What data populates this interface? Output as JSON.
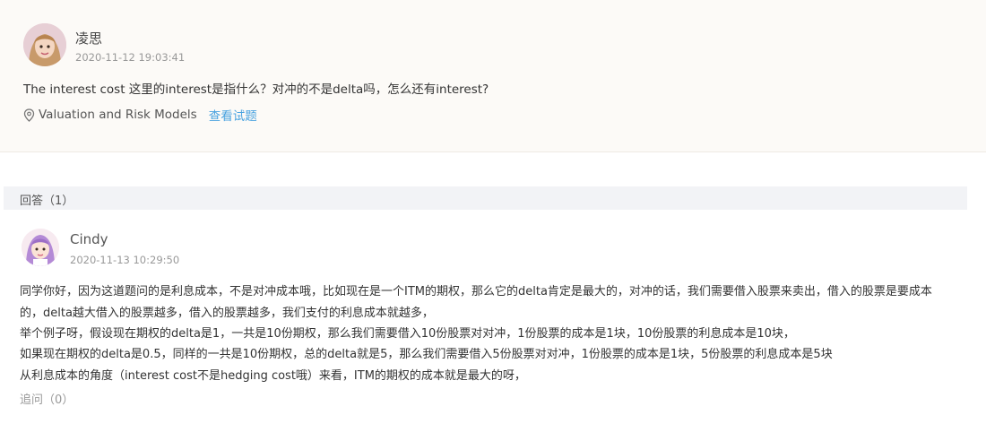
{
  "question": {
    "user_name": "凌思",
    "timestamp": "2020-11-12 19:03:41",
    "text": "The interest cost 这里的interest是指什么？对冲的不是delta吗，怎么还有interest?",
    "tag_icon": "location-pin-icon",
    "tag": "Valuation and Risk Models",
    "view_link": "查看试题"
  },
  "answers_header": "回答（1）",
  "answer": {
    "user_name": "Cindy",
    "timestamp": "2020-11-13 10:29:50",
    "lines": [
      "同学你好，因为这道题问的是利息成本，不是对冲成本哦，比如现在是一个ITM的期权，那么它的delta肯定是最大的，对冲的话，我们需要借入股票来卖出，借入的股票是要成本",
      "的，delta越大借入的股票越多，借入的股票越多，我们支付的利息成本就越多，",
      "举个例子呀，假设现在期权的delta是1，一共是10份期权，那么我们需要借入10份股票对对冲，1份股票的成本是1块，10份股票的利息成本是10块，",
      "如果现在期权的delta是0.5，同样的一共是10份期权，总的delta就是5，那么我们需要借入5份股票对对冲，1份股票的成本是1块，5份股票的利息成本是5块",
      "从利息成本的角度（interest cost不是hedging cost哦）来看，ITM的期权的成本就是最大的呀，"
    ],
    "followup": "追问（0）"
  }
}
